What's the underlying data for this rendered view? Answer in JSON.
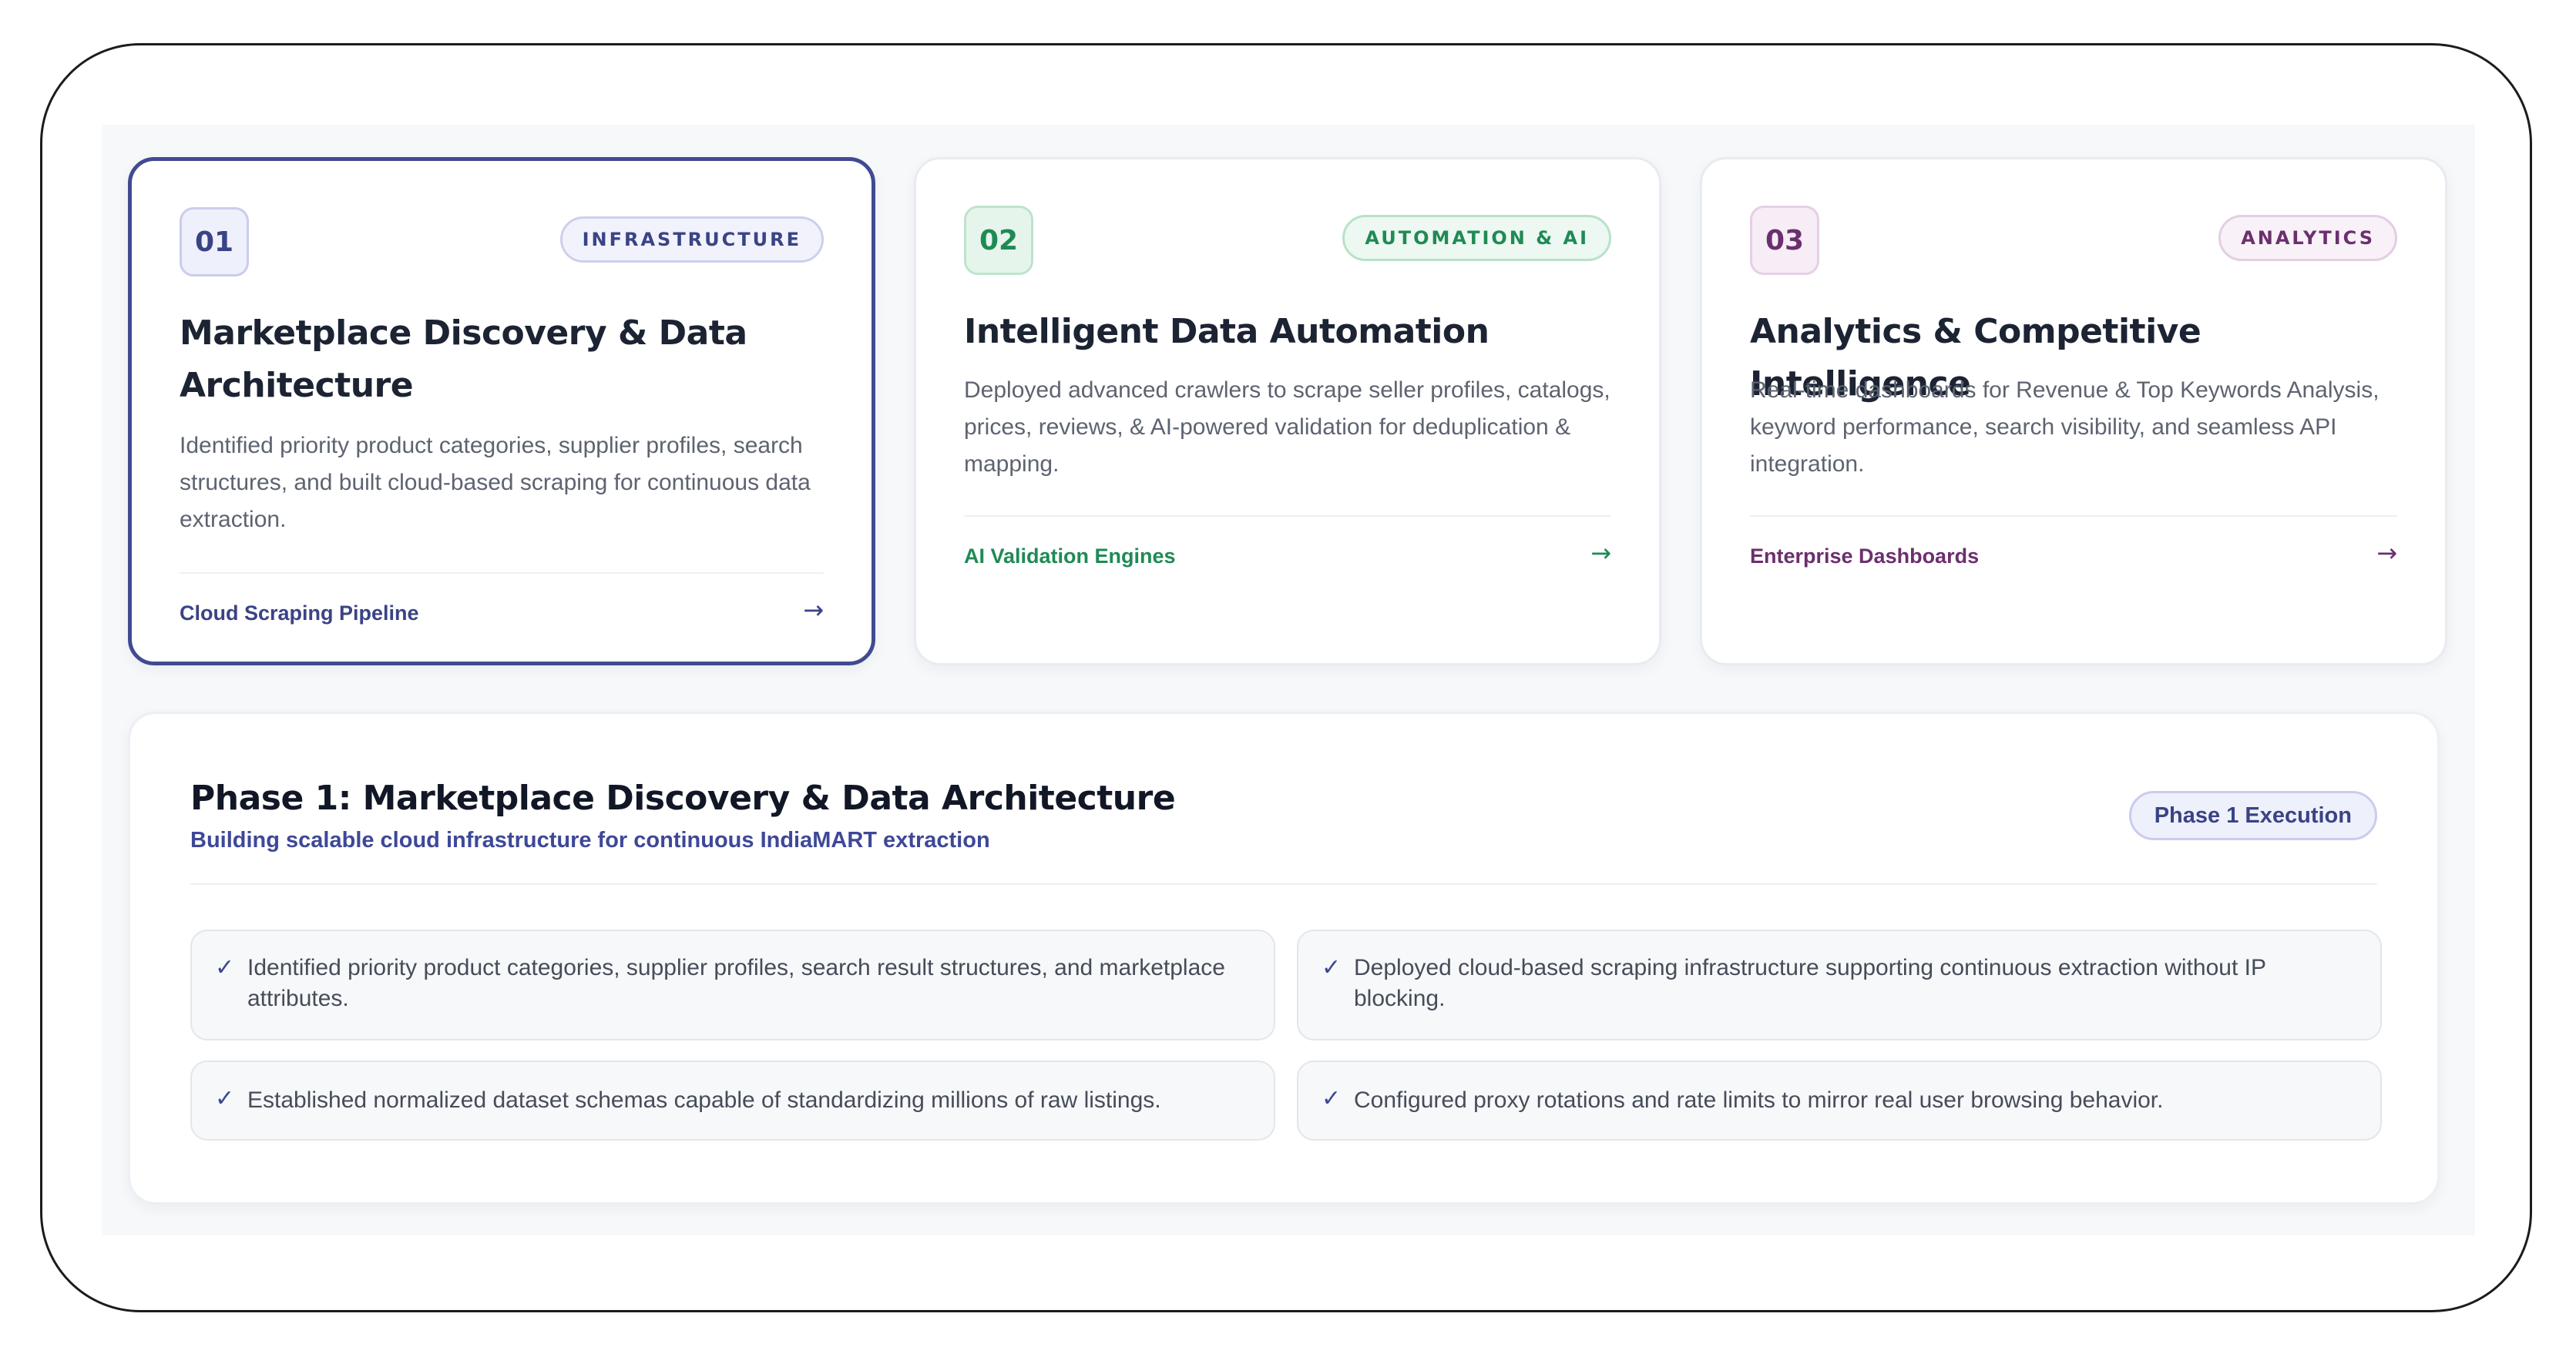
{
  "cards": [
    {
      "number": "01",
      "tag": "INFRASTRUCTURE",
      "title": "Marketplace Discovery & Data Architecture",
      "description": "Identified priority product categories, supplier profiles, search structures, and built cloud-based scraping for continuous data extraction.",
      "footer_label": "Cloud Scraping Pipeline",
      "arrow": "→",
      "active": true,
      "colors": {
        "accent": "#3a4385",
        "num_bg": "#eef0fb",
        "num_border": "#c9cdec",
        "tag_bg": "#f1f2fb",
        "tag_border": "#cdd0ea"
      }
    },
    {
      "number": "02",
      "tag": "AUTOMATION & AI",
      "title": "Intelligent Data Automation",
      "description": "Deployed advanced crawlers to scrape seller profiles, catalogs, prices, reviews, & AI-powered validation for deduplication & mapping.",
      "footer_label": "AI Validation Engines",
      "arrow": "→",
      "active": false,
      "colors": {
        "accent": "#1f8a55",
        "num_bg": "#e6f5ec",
        "num_border": "#bfe3cd",
        "tag_bg": "#ecf8f1",
        "tag_border": "#b8e2c8"
      }
    },
    {
      "number": "03",
      "tag": "ANALYTICS",
      "title": "Analytics & Competitive Intelligence",
      "description": "Real-time dashboards for Revenue & Top Keywords Analysis, keyword performance, search visibility, and seamless API integration.",
      "footer_label": "Enterprise Dashboards",
      "arrow": "→",
      "active": false,
      "colors": {
        "accent": "#6b2f6e",
        "num_bg": "#f6edf6",
        "num_border": "#e5cfe6",
        "tag_bg": "#f8f1f8",
        "tag_border": "#e2cfe3"
      }
    }
  ],
  "phase": {
    "title": "Phase 1: Marketplace Discovery & Data Architecture",
    "subtitle": "Building scalable cloud infrastructure for continuous IndiaMART extraction",
    "badge": "Phase 1 Execution",
    "check_symbol": "✓",
    "items": [
      "Identified priority product categories, supplier profiles, search result structures, and marketplace attributes.",
      "Deployed cloud-based scraping infrastructure supporting continuous extraction without IP blocking.",
      "Established normalized dataset schemas capable of standardizing millions of raw listings.",
      "Configured proxy rotations and rate limits to mirror real user browsing behavior."
    ]
  }
}
